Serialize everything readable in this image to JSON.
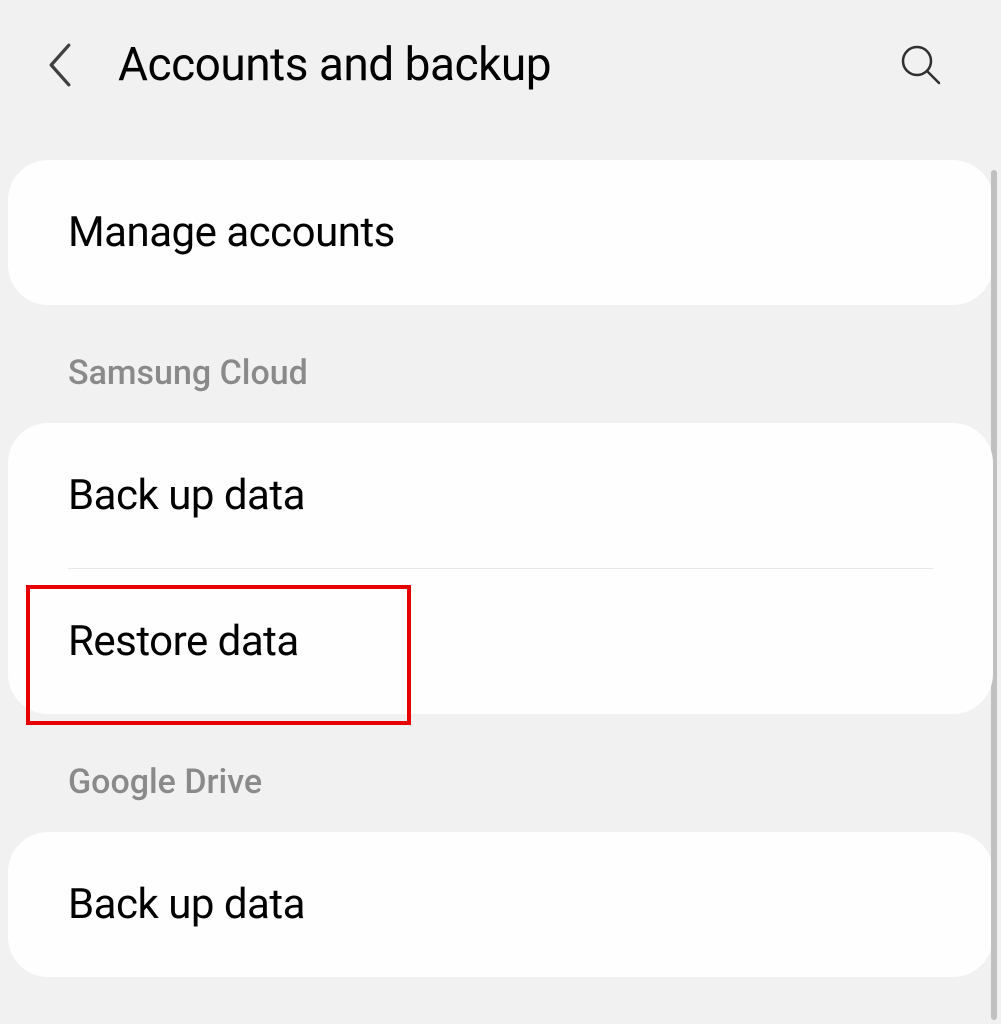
{
  "header": {
    "title": "Accounts and backup"
  },
  "sections": {
    "top": {
      "manage_accounts_label": "Manage accounts"
    },
    "samsung_cloud": {
      "header_label": "Samsung Cloud",
      "backup_label": "Back up data",
      "restore_label": "Restore data"
    },
    "google_drive": {
      "header_label": "Google Drive",
      "backup_label": "Back up data"
    }
  },
  "highlight": {
    "target": "restore-data"
  }
}
